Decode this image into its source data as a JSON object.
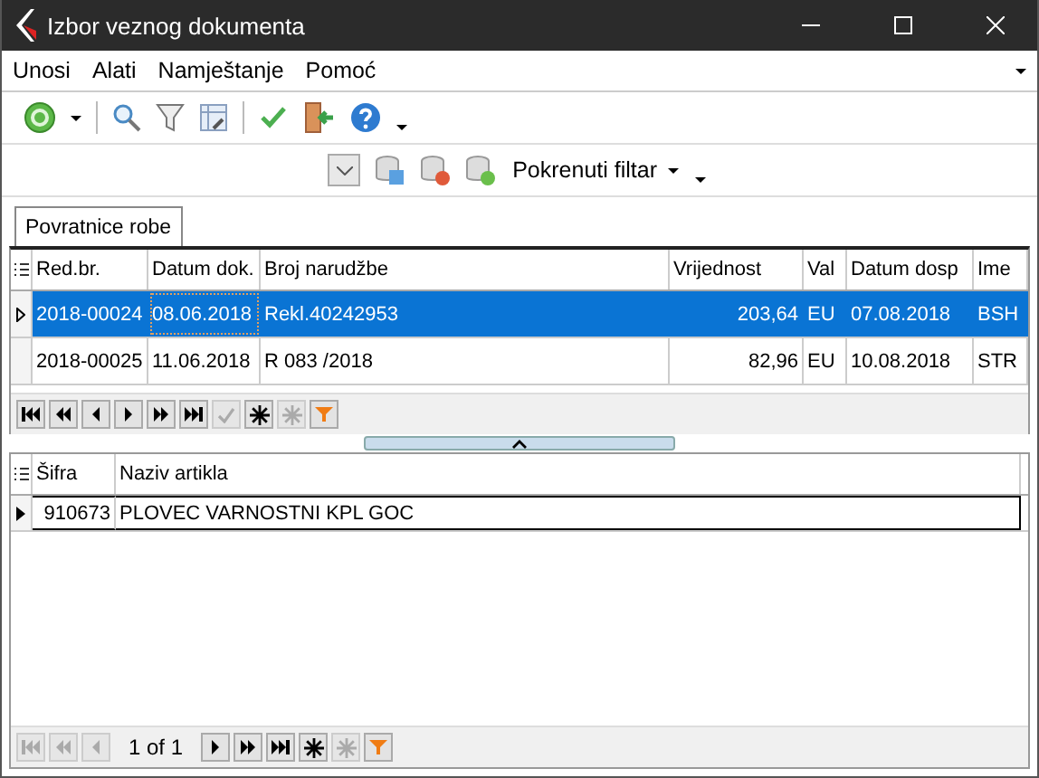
{
  "window": {
    "title": "Izbor veznog dokumenta"
  },
  "menu": [
    "Unosi",
    "Alati",
    "Namještanje",
    "Pomoć"
  ],
  "filter_bar": {
    "button": "Pokrenuti filtar"
  },
  "tabs": [
    {
      "label": "Povratnice robe",
      "selected": true
    }
  ],
  "documents": {
    "columns": [
      "Red.br.",
      "Datum dok.",
      "Broj narudžbe",
      "Vrijednost",
      "Val",
      "Datum dosp",
      "Ime"
    ],
    "rows": [
      {
        "cells": [
          "2018-00024",
          "08.06.2018",
          "Rekl.40242953",
          "203,64",
          "EU",
          "07.08.2018",
          "BSH"
        ],
        "selected": true
      },
      {
        "cells": [
          "2018-00025",
          "11.06.2018",
          "R 083  /2018",
          "82,96",
          "EU",
          "10.08.2018",
          "STR"
        ],
        "selected": false
      }
    ],
    "navigator": [
      {
        "kind": "first",
        "disabled": false
      },
      {
        "kind": "prev-page",
        "disabled": false
      },
      {
        "kind": "prev",
        "disabled": false
      },
      {
        "kind": "next",
        "disabled": false
      },
      {
        "kind": "next-page",
        "disabled": false
      },
      {
        "kind": "last",
        "disabled": false
      },
      {
        "kind": "check",
        "disabled": true
      },
      {
        "kind": "insert",
        "disabled": false
      },
      {
        "kind": "delete",
        "disabled": true
      },
      {
        "kind": "filter",
        "disabled": false
      }
    ]
  },
  "articles": {
    "columns": [
      "Šifra",
      "Naziv artikla"
    ],
    "rows": [
      {
        "cells": [
          "910673",
          "PLOVEC VARNOSTNI KPL GOC"
        ],
        "selected": true
      }
    ],
    "navigator": [
      {
        "kind": "first",
        "disabled": true
      },
      {
        "kind": "prev-page",
        "disabled": true
      },
      {
        "kind": "prev",
        "disabled": true
      },
      {
        "kind": "label",
        "text": "1 of 1"
      },
      {
        "kind": "next",
        "disabled": false
      },
      {
        "kind": "next-page",
        "disabled": false
      },
      {
        "kind": "last",
        "disabled": false
      },
      {
        "kind": "insert",
        "disabled": false
      },
      {
        "kind": "delete",
        "disabled": true
      },
      {
        "kind": "filter",
        "disabled": false
      }
    ]
  }
}
